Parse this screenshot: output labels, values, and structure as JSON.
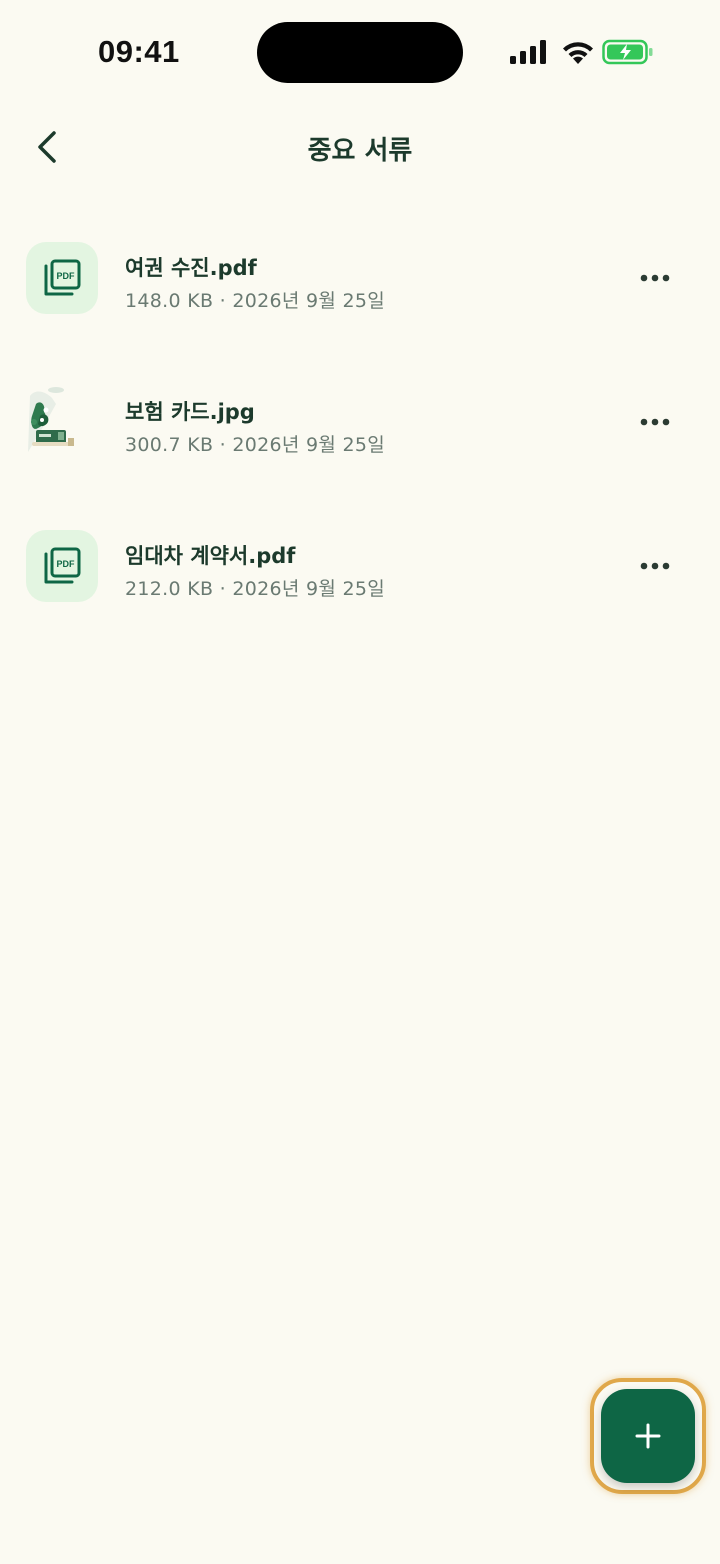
{
  "status_bar": {
    "time": "09:41"
  },
  "header": {
    "title": "중요 서류",
    "back_icon": "chevron-left-icon"
  },
  "files": [
    {
      "name": "여권 수진.pdf",
      "meta": "148.0 KB · 2026년 9월 25일",
      "type": "pdf",
      "thumb_label": "PDF"
    },
    {
      "name": "보험 카드.jpg",
      "meta": "300.7 KB · 2026년 9월 25일",
      "type": "image"
    },
    {
      "name": "임대차 계약서.pdf",
      "meta": "212.0 KB · 2026년 9월 25일",
      "type": "pdf",
      "thumb_label": "PDF"
    }
  ],
  "fab": {
    "icon": "plus-icon"
  },
  "colors": {
    "background": "#FBFAF2",
    "primary": "#0E6645",
    "text_dark": "#1C3A2C",
    "text_muted": "#6A7A72",
    "pdf_thumb_bg": "#E3F5E1",
    "fab_ring": "#E0A84A",
    "battery_green": "#34C759"
  }
}
